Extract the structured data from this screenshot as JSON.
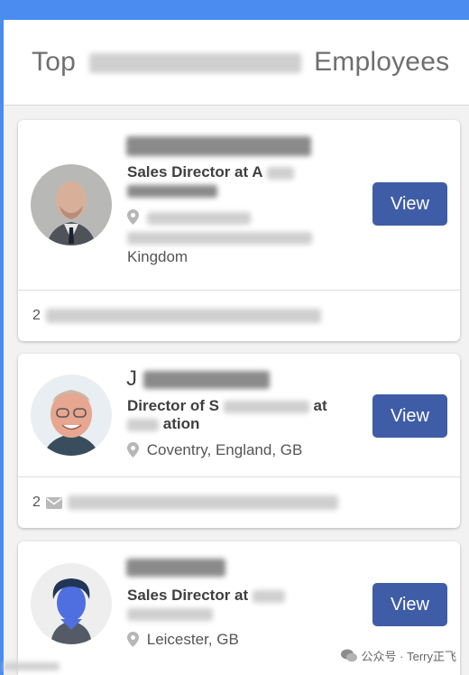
{
  "header": {
    "title_prefix": "Top",
    "title_suffix": "Employees"
  },
  "employees": [
    {
      "title": "Sales Director at A",
      "location_line3": "Kingdom",
      "view_label": "View",
      "footer_count": "2"
    },
    {
      "name_visible": "J",
      "title_line1_a": "Director of S",
      "title_line1_b": "at",
      "title_line2": "ation",
      "location": "Coventry, England, GB",
      "view_label": "View",
      "footer_count": "2"
    },
    {
      "title": "Sales Director at",
      "location": "Leicester, GB",
      "view_label": "View"
    }
  ],
  "watermark": {
    "text": "公众号 · Terry正飞"
  },
  "colors": {
    "accent": "#3f5da6",
    "background": "#4a8cf0"
  }
}
